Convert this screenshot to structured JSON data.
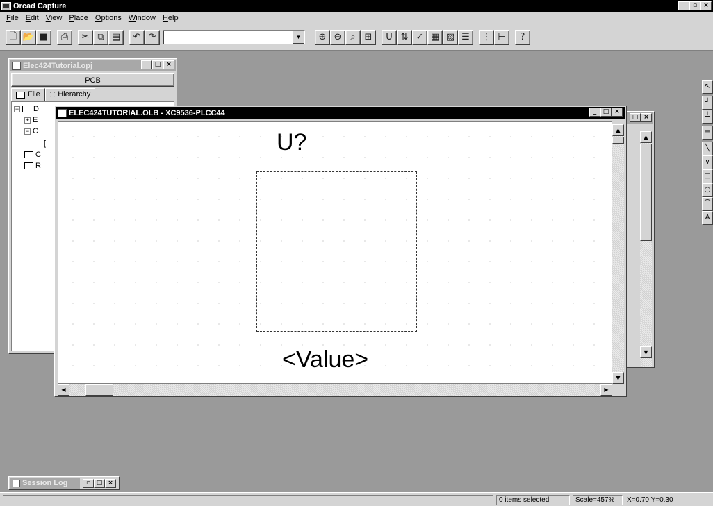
{
  "app": {
    "title": "Orcad Capture"
  },
  "menu": [
    {
      "label": "File",
      "ul": "F",
      "rest": "ile"
    },
    {
      "label": "Edit",
      "ul": "E",
      "rest": "dit"
    },
    {
      "label": "View",
      "ul": "V",
      "rest": "iew"
    },
    {
      "label": "Place",
      "ul": "P",
      "rest": "lace"
    },
    {
      "label": "Options",
      "ul": "O",
      "rest": "ptions"
    },
    {
      "label": "Window",
      "ul": "W",
      "rest": "indow"
    },
    {
      "label": "Help",
      "ul": "H",
      "rest": "elp"
    }
  ],
  "toolbar": {
    "combo_value": "",
    "icons": [
      "new-icon",
      "open-icon",
      "save-icon",
      "print-icon",
      "cut-icon",
      "copy-icon",
      "paste-icon",
      "undo-icon",
      "redo-icon"
    ],
    "icons_right": [
      "zoom-in-icon",
      "zoom-out-icon",
      "zoom-area-icon",
      "zoom-all-icon",
      "annotate-icon",
      "back-annotate-icon",
      "drc-icon",
      "netlist-icon",
      "cross-reference-icon",
      "bill-of-materials-icon",
      "snap-to-grid-icon",
      "project-manager-icon",
      "help-icon"
    ]
  },
  "project_window": {
    "title": "Elec424Tutorial.opj",
    "band": "PCB",
    "tabs": {
      "file": "File",
      "hierarchy": "Hierarchy"
    },
    "tree": [
      {
        "label": "D"
      },
      {
        "label": "E"
      },
      {
        "label": "C"
      },
      {
        "label": "["
      },
      {
        "label": "C"
      },
      {
        "label": "R"
      }
    ]
  },
  "library_window": {
    "title": "ELEC424TUTORIAL.OLB - XC9536-PLCC44",
    "part_reference": "U?",
    "part_value": "<Value>"
  },
  "session_log": {
    "title": "Session Log"
  },
  "status": {
    "selection": "0 items selected",
    "scale": "Scale=457%",
    "coords": "X=0.70  Y=0.30"
  }
}
